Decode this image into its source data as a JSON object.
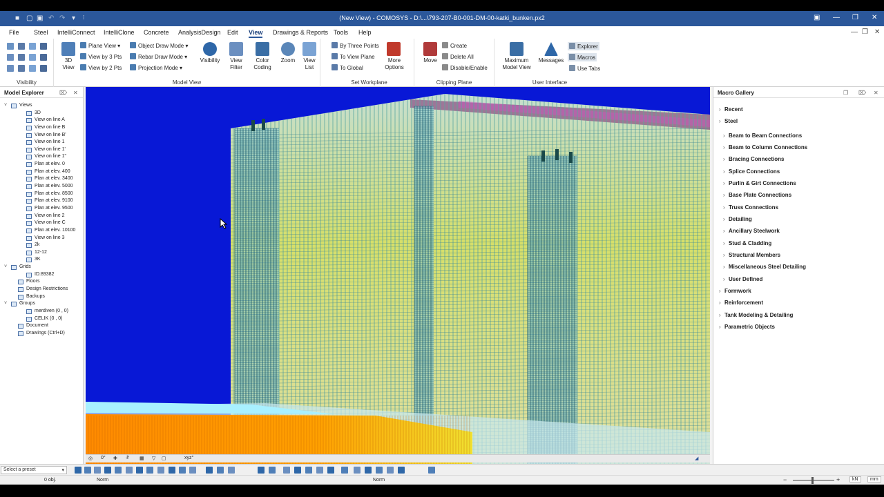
{
  "window": {
    "title": "(New View) - COMOSYS - D:\\...\\793-207-B0-001-DM-00-katki_bunken.px2"
  },
  "menu": [
    "File",
    "Steel",
    "IntelliConnect",
    "IntelliClone",
    "Concrete",
    "AnalysisDesign",
    "Edit",
    "View",
    "Drawings & Reports",
    "Tools",
    "Help"
  ],
  "active_menu": "View",
  "ribbon": {
    "visibility_group": "Visibility",
    "model_view": {
      "label": "Model View",
      "view3d": "3D\nView",
      "plane_view": "Plane View",
      "view3pts": "View by 3 Pts",
      "view2pts": "View by 2 Pts",
      "object_draw": "Object Draw Mode",
      "rebar_draw": "Rebar Draw Mode",
      "projection": "Projection Mode",
      "visibility": "Visibility",
      "view_filter": "View\nFilter",
      "color_coding": "Color\nCoding",
      "zoom": "Zoom",
      "view_list": "View\nList"
    },
    "set_workplane": {
      "label": "Set Workplane",
      "by_three": "By Three Points",
      "to_view": "To View Plane",
      "to_global": "To Global",
      "more": "More\nOptions"
    },
    "clipping": {
      "label": "Clipping Plane",
      "move": "Move",
      "create": "Create",
      "delete_all": "Delete All",
      "disable": "Disable/Enable"
    },
    "ui": {
      "label": "User Interface",
      "max_view": "Maximum\nModel View",
      "messages": "Messages",
      "explorer": "Explorer",
      "macros": "Macros",
      "use_tabs": "Use Tabs"
    }
  },
  "model_explorer": {
    "title": "Model Explorer",
    "nodes": [
      {
        "label": "Views",
        "level": 0,
        "toggle": "v",
        "icon": "folder-icon"
      },
      {
        "label": "3D",
        "level": 2,
        "icon": "view-icon"
      },
      {
        "label": "View on line A",
        "level": 2,
        "icon": "view-icon"
      },
      {
        "label": "View on line B",
        "level": 2,
        "icon": "view-icon"
      },
      {
        "label": "View on line B'",
        "level": 2,
        "icon": "view-icon"
      },
      {
        "label": "View on line 1",
        "level": 2,
        "icon": "view-icon"
      },
      {
        "label": "View on line 1'",
        "level": 2,
        "icon": "view-icon"
      },
      {
        "label": "View on line 1\"",
        "level": 2,
        "icon": "view-icon"
      },
      {
        "label": "Plan at elev. 0",
        "level": 2,
        "icon": "view-icon"
      },
      {
        "label": "Plan at elev. 400",
        "level": 2,
        "icon": "view-icon"
      },
      {
        "label": "Plan at elev. 3400",
        "level": 2,
        "icon": "view-icon"
      },
      {
        "label": "Plan at elev. 5000",
        "level": 2,
        "icon": "view-icon"
      },
      {
        "label": "Plan at elev. 8500",
        "level": 2,
        "icon": "view-icon"
      },
      {
        "label": "Plan at elev. 9100",
        "level": 2,
        "icon": "view-icon"
      },
      {
        "label": "Plan at elev. 9500",
        "level": 2,
        "icon": "view-icon"
      },
      {
        "label": "View on line 2",
        "level": 2,
        "icon": "view-icon"
      },
      {
        "label": "View on line C",
        "level": 2,
        "icon": "view-icon"
      },
      {
        "label": "Plan at elev. 10100",
        "level": 2,
        "icon": "view-icon"
      },
      {
        "label": "View on line 3",
        "level": 2,
        "icon": "view-icon"
      },
      {
        "label": "2k",
        "level": 2,
        "icon": "view-icon"
      },
      {
        "label": "12-12",
        "level": 2,
        "icon": "view-icon"
      },
      {
        "label": "3K",
        "level": 2,
        "icon": "view-icon"
      },
      {
        "label": "Grids",
        "level": 0,
        "toggle": "v",
        "icon": "grid-icon"
      },
      {
        "label": "ID:89382",
        "level": 2,
        "icon": "grid-icon"
      },
      {
        "label": "Floors",
        "level": 1,
        "icon": "floors-icon"
      },
      {
        "label": "Design Restrictions",
        "level": 1,
        "icon": "restriction-icon"
      },
      {
        "label": "Backups",
        "level": 1,
        "icon": "backup-icon"
      },
      {
        "label": "Groups",
        "level": 0,
        "toggle": "v",
        "icon": "group-icon"
      },
      {
        "label": "merdiven (0 , 0)",
        "level": 2,
        "icon": "group-icon"
      },
      {
        "label": "CELIK (0 , 0)",
        "level": 2,
        "icon": "group-icon"
      },
      {
        "label": "Document",
        "level": 1,
        "icon": "document-icon"
      },
      {
        "label": "Drawings (Ctrl+D)",
        "level": 1,
        "icon": "drawing-icon"
      }
    ]
  },
  "macro_gallery": {
    "title": "Macro Gallery",
    "items": [
      {
        "label": "Recent",
        "level": 0
      },
      {
        "label": "Steel",
        "level": 0
      },
      {
        "label": "Beam to Beam Connections",
        "level": 1
      },
      {
        "label": "Beam to Column Connections",
        "level": 1
      },
      {
        "label": "Bracing Connections",
        "level": 1
      },
      {
        "label": "Splice Connections",
        "level": 1
      },
      {
        "label": "Purlin & Girt Connections",
        "level": 1
      },
      {
        "label": "Base Plate Connections",
        "level": 1
      },
      {
        "label": "Truss Connections",
        "level": 1
      },
      {
        "label": "Detailing",
        "level": 1
      },
      {
        "label": "Ancillary Steelwork",
        "level": 1
      },
      {
        "label": "Stud & Cladding",
        "level": 1
      },
      {
        "label": "Structural Members",
        "level": 1
      },
      {
        "label": "Miscellaneous Steel Detailing",
        "level": 1
      },
      {
        "label": "User Defined",
        "level": 1
      },
      {
        "label": "Formwork",
        "level": 0
      },
      {
        "label": "Reinforcement",
        "level": 0
      },
      {
        "label": "Tank Modeling & Detailing",
        "level": 0
      },
      {
        "label": "Parametric Objects",
        "level": 0
      }
    ]
  },
  "viewport_toolbar": {
    "angle": "0°",
    "ucs": "xyz°"
  },
  "status": {
    "preset_placeholder": "Select a preset",
    "obj_count": "0 obj.",
    "mode": "Norm",
    "center": "Norm",
    "unit_force": "kN",
    "unit_length": "mm"
  },
  "colors": {
    "accent": "#2b579a",
    "viewport_bg": "#0818d6"
  }
}
